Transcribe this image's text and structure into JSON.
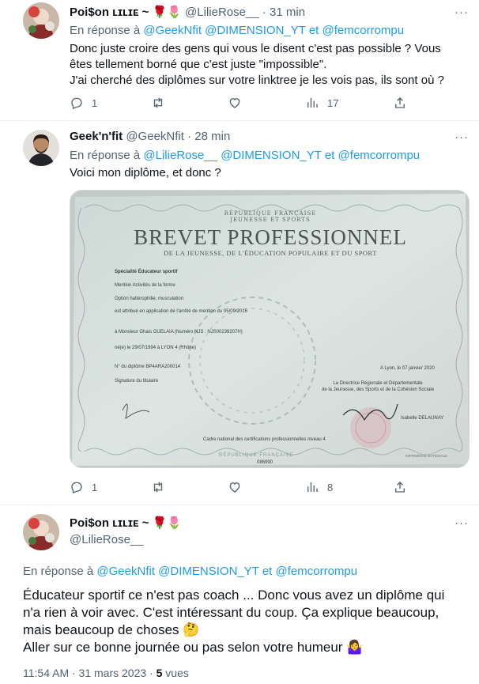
{
  "tweet1": {
    "display_name": "Poi$on ʟɪʟɪᴇ ~",
    "handle": "@LilieRose__",
    "time": "31 min",
    "reply_prefix": "En réponse à",
    "mentions": [
      "@GeekNfit",
      "@DIMENSION_YT",
      "et",
      "@femcorrompu"
    ],
    "text_lines": [
      "Donc juste croire des gens qui vous le disent c'est pas possible ? Vous",
      "êtes tellement borné que c'est juste \"impossible\".",
      "J'ai cherché des diplômes sur votre linktree je les vois pas, ils sont où ?"
    ],
    "stats": {
      "replies": "1",
      "retweets": "",
      "likes": "",
      "views": "17"
    }
  },
  "tweet2": {
    "display_name": "Geek'n'fit",
    "handle": "@GeekNfit",
    "time": "28 min",
    "reply_prefix": "En réponse à",
    "mentions": [
      "@LilieRose__",
      "@DIMENSION_YT",
      "et",
      "@femcorrompu"
    ],
    "text": "Voici mon diplôme, et donc ?",
    "stats": {
      "replies": "1",
      "retweets": "",
      "likes": "",
      "views": "8"
    },
    "diploma": {
      "header_line1": "RÉPUBLIQUE FRANÇAISE",
      "header_line2": "JEUNESSE ET SPORTS",
      "title": "BREVET PROFESSIONNEL",
      "subtitle": "DE LA JEUNESSE, DE L'ÉDUCATION POPULAIRE ET DU SPORT",
      "lines": [
        "Spécialité Éducateur sportif",
        "Mention Activités de la forme",
        "Option haltérophilie, musculation",
        "est attribué en application de l'arrêté de mention du 05/09/2016",
        "à Monsieur Ghais GUELAIA (Numéro NJS : NJS00239207H)",
        "né(e) le 29/07/1994 à LYON 4 (Rhône)",
        "N° du diplôme BP4ARA200014",
        "Signature du titulaire"
      ],
      "place_date": "A Lyon, le 07 janvier 2020",
      "authority": [
        "La Directrice Régionale et Départementale",
        "de la Jeunesse, des Sports et de la Cohésion Sociale"
      ],
      "signatory": "Isabelle DELAUNAY",
      "footer": "Cadre national des certifications professionnelles niveau 4",
      "bottom_left": "RÉPUBLIQUE FRANÇAISE",
      "bottom_right": "IMPRIMERIE NATIONALE",
      "serial": "086990"
    }
  },
  "tweet3": {
    "display_name": "Poi$on ʟɪʟɪᴇ ~",
    "handle": "@LilieRose__",
    "reply_prefix": "En réponse à",
    "mentions": [
      "@GeekNfit",
      "@DIMENSION_YT",
      "et",
      "@femcorrompu"
    ],
    "text_lines": [
      "Éducateur sportif ce n'est pas coach ... Donc vous avez un diplôme qui",
      "n'a rien à voir avec. C'est intéressant du coup. Ça explique beaucoup,",
      "mais beaucoup de choses 🤔",
      "Aller sur ce bonne journée ou pas selon votre humeur 🤷‍♀️"
    ],
    "timestamp": "11:54 AM · 31 mars 2023 ·",
    "views_count": "5",
    "views_label": "vues"
  },
  "emoji": {
    "rose": "🌹",
    "tulip": "🌷"
  },
  "colors": {
    "link": "#1d9bf0",
    "muted": "#536471",
    "text": "#0f1419",
    "border": "#eff3f4"
  }
}
